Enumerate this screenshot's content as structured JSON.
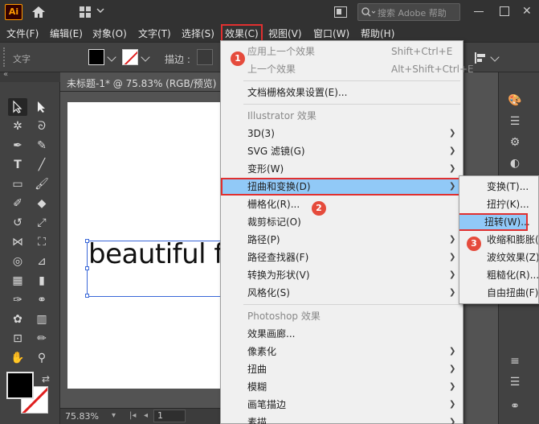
{
  "app": {
    "logo_text": "Ai",
    "search_placeholder": "搜索 Adobe 帮助"
  },
  "menubar": {
    "items": [
      "文件(F)",
      "编辑(E)",
      "对象(O)",
      "文字(T)",
      "选择(S)",
      "效果(C)",
      "视图(V)",
      "窗口(W)",
      "帮助(H)"
    ],
    "active": "效果(C)"
  },
  "controlbar": {
    "type_label": "文字",
    "stroke_label": "描边 :"
  },
  "document": {
    "tab_title": "未标题-1* @ 75.83% (RGB/预览)",
    "art_text": "beautiful f",
    "zoom": "75.83%",
    "page": "1"
  },
  "effect_menu": {
    "items": [
      {
        "label": "应用上一个效果",
        "shortcut": "Shift+Ctrl+E",
        "state": "disabled"
      },
      {
        "label": "上一个效果",
        "shortcut": "Alt+Shift+Ctrl+E",
        "state": "disabled"
      },
      {
        "label": "文档栅格效果设置(E)...",
        "state": "normal"
      },
      {
        "label": "Illustrator 效果",
        "state": "header"
      },
      {
        "label": "3D(3)",
        "submenu": true
      },
      {
        "label": "SVG 滤镜(G)",
        "submenu": true
      },
      {
        "label": "变形(W)",
        "submenu": true
      },
      {
        "label": "扭曲和变换(D)",
        "submenu": true,
        "state": "highlighted"
      },
      {
        "label": "栅格化(R)..."
      },
      {
        "label": "裁剪标记(O)"
      },
      {
        "label": "路径(P)",
        "submenu": true
      },
      {
        "label": "路径查找器(F)",
        "submenu": true
      },
      {
        "label": "转换为形状(V)",
        "submenu": true
      },
      {
        "label": "风格化(S)",
        "submenu": true
      },
      {
        "label": "Photoshop 效果",
        "state": "header"
      },
      {
        "label": "效果画廊..."
      },
      {
        "label": "像素化",
        "submenu": true
      },
      {
        "label": "扭曲",
        "submenu": true
      },
      {
        "label": "模糊",
        "submenu": true
      },
      {
        "label": "画笔描边",
        "submenu": true
      },
      {
        "label": "素描",
        "submenu": true
      }
    ]
  },
  "distort_submenu": {
    "items": [
      "变换(T)...",
      "扭拧(K)...",
      "扭转(W)...",
      "收缩和膨胀(",
      "波纹效果(Z)...",
      "粗糙化(R)...",
      "自由扭曲(F)..."
    ],
    "highlighted": "扭转(W)..."
  },
  "steps": [
    "1",
    "2",
    "3"
  ],
  "colors": {
    "highlight": "#91c9f7",
    "annotation": "#e03030",
    "badge": "#e54b3c"
  }
}
